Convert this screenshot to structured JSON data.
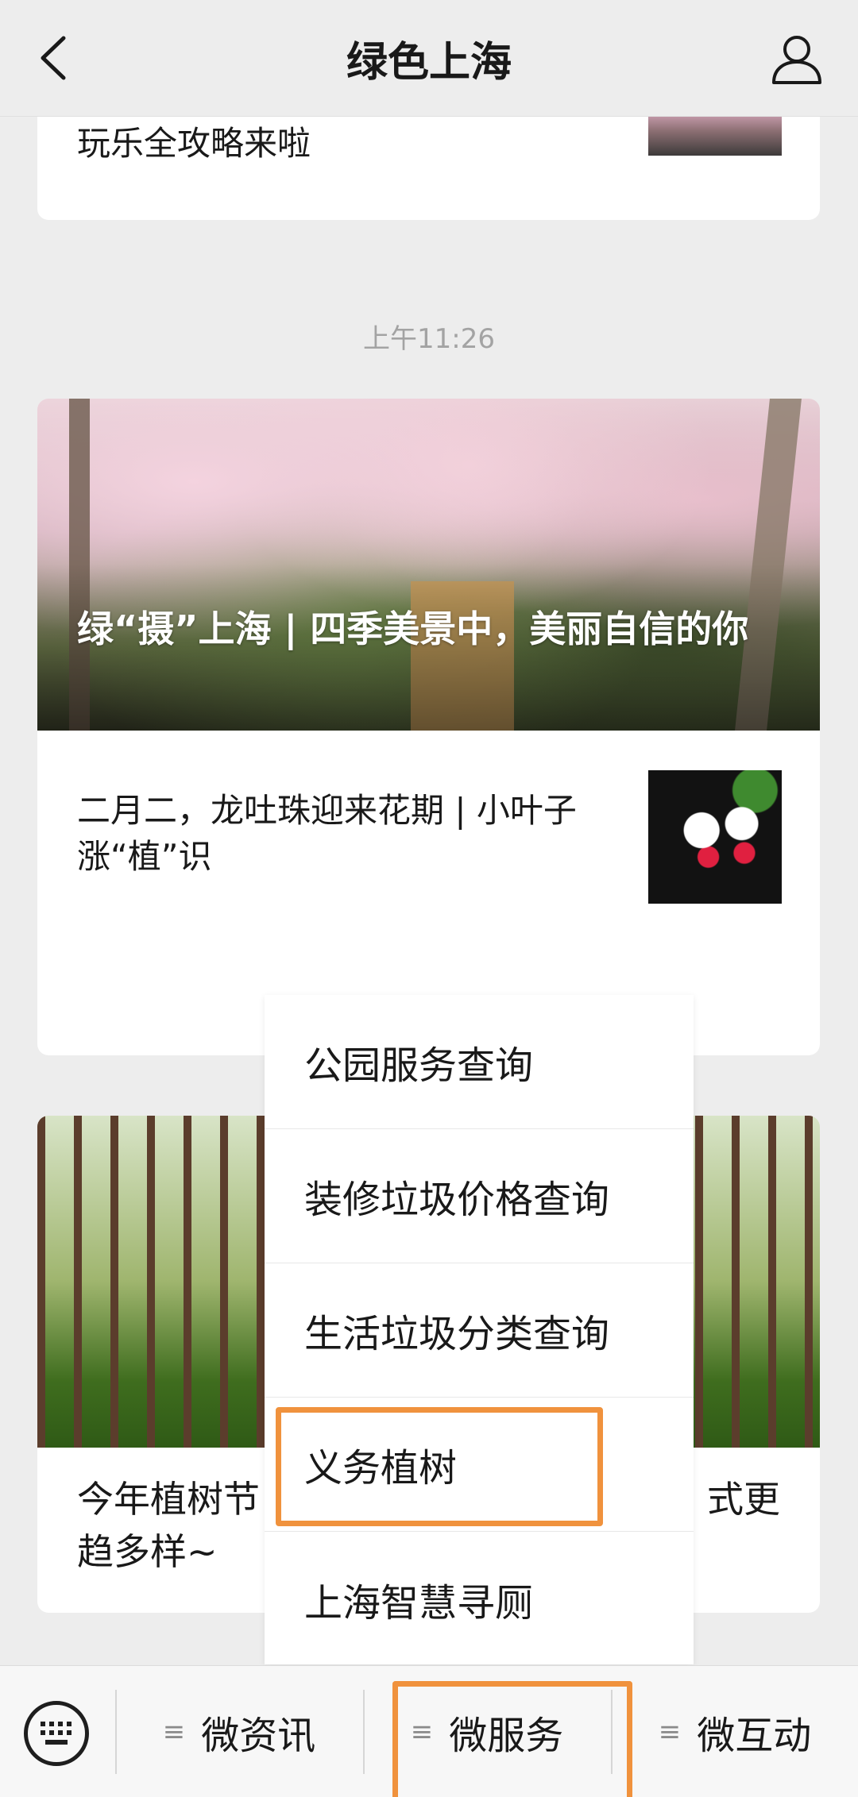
{
  "header": {
    "title": "绿色上海",
    "back_icon": "chevron-left-icon",
    "profile_icon": "person-icon"
  },
  "feed": {
    "card1": {
      "title": "玩乐全攻略来啦"
    },
    "timestamp": "上午11:26",
    "card2": {
      "headline": "绿“摄”上海 | 四季美景中，美丽自信的你",
      "sub_title": "二月二，龙吐珠迎来花期 | 小叶子涨“植”识"
    },
    "card3": {
      "title_left": "今年植树节",
      "title_right": "式更",
      "title_line2": "趋多样~"
    }
  },
  "menu": {
    "items": [
      {
        "label": "公园服务查询"
      },
      {
        "label": "装修垃圾价格查询"
      },
      {
        "label": "生活垃圾分类查询"
      },
      {
        "label": "义务植树"
      },
      {
        "label": "上海智慧寻厕"
      }
    ],
    "highlighted_index": 3
  },
  "bottom_bar": {
    "keyboard_icon": "keyboard-icon",
    "tabs": [
      {
        "label": "微资讯"
      },
      {
        "label": "微服务"
      },
      {
        "label": "微互动"
      }
    ],
    "menu_glyph": "≡"
  },
  "colors": {
    "highlight": "#f0923d",
    "background": "#ededed"
  }
}
